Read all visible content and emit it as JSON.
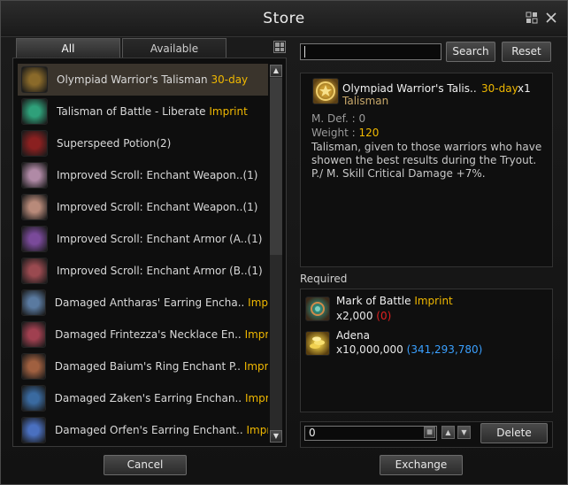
{
  "window": {
    "title": "Store"
  },
  "tabs": [
    {
      "label": "All"
    },
    {
      "label": "Available"
    }
  ],
  "items": [
    {
      "name": "Olympiad Warrior's Talisman",
      "tag": "30-day",
      "selected": true,
      "icon_color": "#8a6a2a"
    },
    {
      "name": "Talisman of Battle - Liberate",
      "tag": "Imprint",
      "icon_color": "#2fa07a"
    },
    {
      "name": "Superspeed Potion(2)",
      "tag": "",
      "icon_color": "#8a2020"
    },
    {
      "name": "Improved Scroll: Enchant Weapon..(1)",
      "tag": "",
      "icon_color": "#b08aa6"
    },
    {
      "name": "Improved Scroll: Enchant Weapon..(1)",
      "tag": "",
      "icon_color": "#b88a7a"
    },
    {
      "name": "Improved Scroll: Enchant Armor (A..(1)",
      "tag": "",
      "icon_color": "#7a4a9a"
    },
    {
      "name": "Improved Scroll: Enchant Armor (B..(1)",
      "tag": "",
      "icon_color": "#9a4a50"
    },
    {
      "name": "Damaged Antharas' Earring Encha..",
      "tag": "Imprint",
      "icon_color": "#5a7aa0"
    },
    {
      "name": "Damaged Frintezza's Necklace En..",
      "tag": "Imprint",
      "icon_color": "#a04050"
    },
    {
      "name": "Damaged Baium's Ring Enchant P..",
      "tag": "Imprint(",
      "icon_color": "#a06040"
    },
    {
      "name": "Damaged Zaken's Earring Enchan..",
      "tag": "Imprint(",
      "icon_color": "#3a6aa0"
    },
    {
      "name": "Damaged Orfen's Earring Enchant..",
      "tag": "Imprint",
      "icon_color": "#4a70c0"
    }
  ],
  "search": {
    "value": "",
    "button": "Search",
    "reset": "Reset"
  },
  "detail": {
    "name": "Olympiad Warrior's Talis..",
    "duration": "30-day",
    "count": "x1",
    "type": "Talisman",
    "mdef": "M. Def. : 0",
    "weight_label": "Weight : ",
    "weight_value": "120",
    "description_lines": [
      "Talisman, given to those warriors who have",
      "showen the best results during the Tryout.",
      "P./ M. Skill Critical Damage +7%."
    ]
  },
  "required": {
    "label": "Required",
    "items": [
      {
        "name": "Mark of Battle",
        "tag": "Imprint",
        "qty": "x2,000",
        "have": "(0)",
        "have_color": "#e02020"
      },
      {
        "name": "Adena",
        "tag": "",
        "qty": "x10,000,000",
        "have": "(341,293,780)",
        "have_color": "#3aa0ff"
      }
    ]
  },
  "quantity": {
    "value": "0",
    "delete": "Delete"
  },
  "buttons": {
    "cancel": "Cancel",
    "exchange": "Exchange"
  },
  "colors": {
    "accent": "#f0b800",
    "selected_row": "#3a342c"
  }
}
